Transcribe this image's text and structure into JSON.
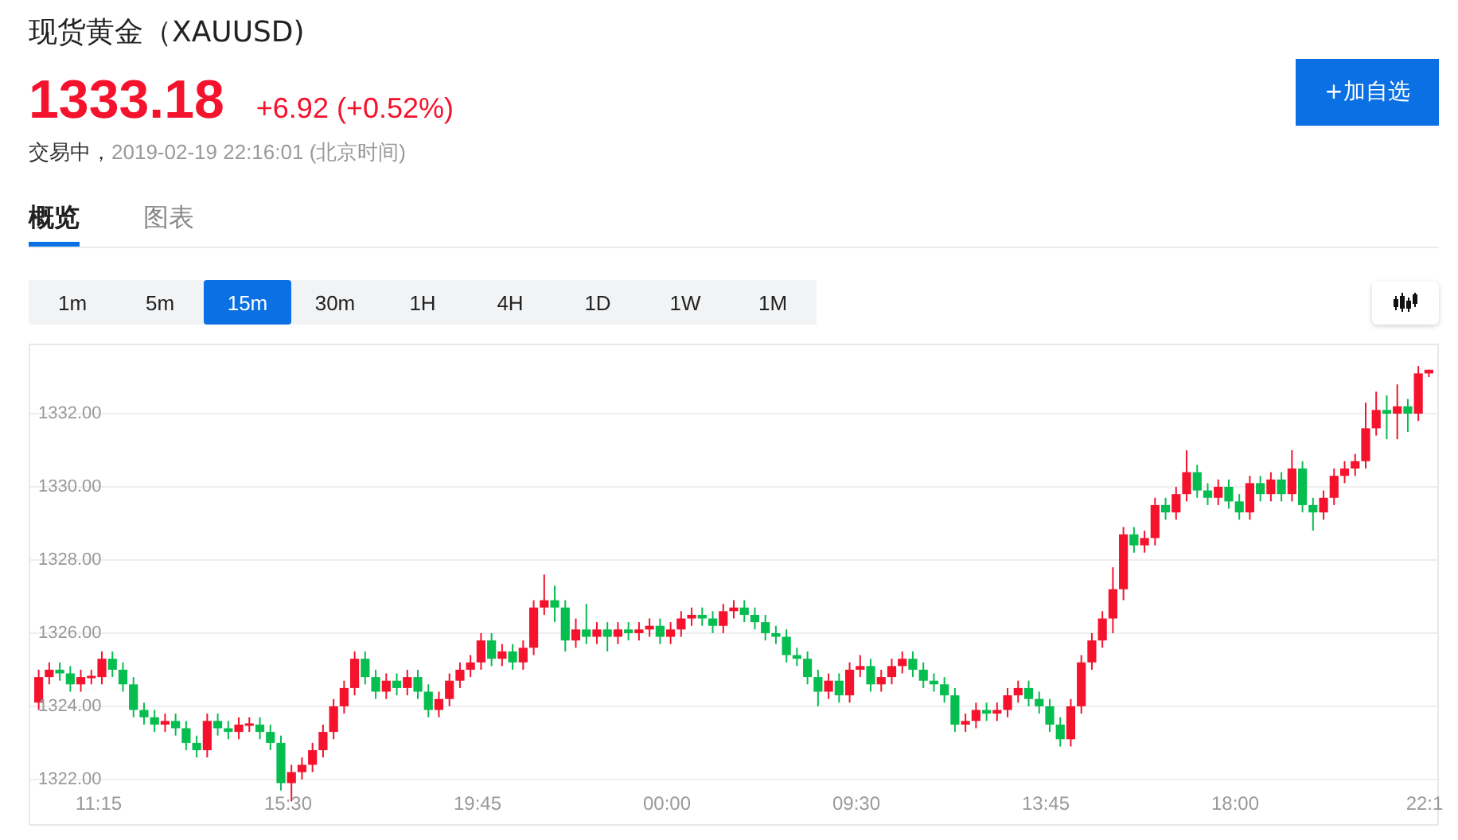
{
  "header": {
    "title": "现货黄金（XAUUSD)",
    "price": "1333.18",
    "change": "+6.92 (+0.52%)",
    "status": "交易中，",
    "time": "2019-02-19 22:16:01 (北京时间)"
  },
  "follow_button": "+加自选",
  "tabs": [
    {
      "label": "概览",
      "selected": true
    },
    {
      "label": "图表",
      "selected": false
    }
  ],
  "periods": [
    {
      "label": "1m",
      "selected": false
    },
    {
      "label": "5m",
      "selected": false
    },
    {
      "label": "15m",
      "selected": true
    },
    {
      "label": "30m",
      "selected": false
    },
    {
      "label": "1H",
      "selected": false
    },
    {
      "label": "4H",
      "selected": false
    },
    {
      "label": "1D",
      "selected": false
    },
    {
      "label": "1W",
      "selected": false
    },
    {
      "label": "1M",
      "selected": false
    }
  ],
  "chart": {
    "x_labels": [
      "11:15",
      "15:30",
      "19:45",
      "00:00",
      "09:30",
      "13:45",
      "18:00",
      "22:1"
    ],
    "chart_data": {
      "type": "candlestick",
      "grid": true,
      "ylim": [
        1320.78,
        1333.87
      ],
      "yticks": [
        {
          "value": 1332,
          "label": "1332.00"
        },
        {
          "value": 1330,
          "label": "1330.00"
        },
        {
          "value": 1328,
          "label": "1328.00"
        },
        {
          "value": 1326,
          "label": "1326.00"
        },
        {
          "value": 1324,
          "label": "1324.00"
        },
        {
          "value": 1322,
          "label": "1322.00"
        }
      ],
      "ohlc": [
        [
          1324.1,
          1325.0,
          1323.9,
          1324.8
        ],
        [
          1324.8,
          1325.2,
          1324.6,
          1325.0
        ],
        [
          1325.0,
          1325.2,
          1324.7,
          1324.9
        ],
        [
          1324.9,
          1325.1,
          1324.4,
          1324.6
        ],
        [
          1324.6,
          1325.0,
          1324.4,
          1324.8
        ],
        [
          1324.8,
          1325.0,
          1324.6,
          1324.8
        ],
        [
          1324.8,
          1325.5,
          1324.6,
          1325.3
        ],
        [
          1325.3,
          1325.5,
          1324.8,
          1325.0
        ],
        [
          1325.0,
          1325.2,
          1324.4,
          1324.6
        ],
        [
          1324.6,
          1324.8,
          1323.7,
          1323.9
        ],
        [
          1323.9,
          1324.1,
          1323.5,
          1323.7
        ],
        [
          1323.7,
          1323.9,
          1323.3,
          1323.5
        ],
        [
          1323.5,
          1323.8,
          1323.3,
          1323.6
        ],
        [
          1323.6,
          1323.8,
          1323.2,
          1323.4
        ],
        [
          1323.4,
          1323.6,
          1322.8,
          1323.0
        ],
        [
          1323.0,
          1323.2,
          1322.6,
          1322.8
        ],
        [
          1322.8,
          1323.8,
          1322.6,
          1323.6
        ],
        [
          1323.6,
          1323.8,
          1323.2,
          1323.4
        ],
        [
          1323.4,
          1323.6,
          1323.1,
          1323.3
        ],
        [
          1323.3,
          1323.7,
          1323.1,
          1323.5
        ],
        [
          1323.5,
          1323.7,
          1323.3,
          1323.5
        ],
        [
          1323.5,
          1323.7,
          1323.1,
          1323.3
        ],
        [
          1323.3,
          1323.5,
          1322.8,
          1323.0
        ],
        [
          1323.0,
          1323.2,
          1321.7,
          1321.9
        ],
        [
          1321.9,
          1322.4,
          1321.4,
          1322.2
        ],
        [
          1322.2,
          1322.6,
          1322.0,
          1322.4
        ],
        [
          1322.4,
          1323.0,
          1322.2,
          1322.8
        ],
        [
          1322.8,
          1323.5,
          1322.6,
          1323.3
        ],
        [
          1323.3,
          1324.2,
          1323.1,
          1324.0
        ],
        [
          1324.0,
          1324.7,
          1323.8,
          1324.5
        ],
        [
          1324.5,
          1325.5,
          1324.3,
          1325.3
        ],
        [
          1325.3,
          1325.5,
          1324.6,
          1324.8
        ],
        [
          1324.8,
          1325.0,
          1324.2,
          1324.4
        ],
        [
          1324.4,
          1324.9,
          1324.2,
          1324.7
        ],
        [
          1324.7,
          1324.9,
          1324.3,
          1324.5
        ],
        [
          1324.5,
          1325.0,
          1324.3,
          1324.8
        ],
        [
          1324.8,
          1325.0,
          1324.2,
          1324.4
        ],
        [
          1324.4,
          1324.6,
          1323.7,
          1323.9
        ],
        [
          1323.9,
          1324.4,
          1323.7,
          1324.2
        ],
        [
          1324.2,
          1324.9,
          1324.0,
          1324.7
        ],
        [
          1324.7,
          1325.2,
          1324.5,
          1325.0
        ],
        [
          1325.0,
          1325.4,
          1324.8,
          1325.2
        ],
        [
          1325.2,
          1326.0,
          1325.0,
          1325.8
        ],
        [
          1325.8,
          1326.0,
          1325.1,
          1325.3
        ],
        [
          1325.3,
          1325.7,
          1325.1,
          1325.5
        ],
        [
          1325.5,
          1325.7,
          1325.0,
          1325.2
        ],
        [
          1325.2,
          1325.8,
          1325.0,
          1325.6
        ],
        [
          1325.6,
          1326.9,
          1325.4,
          1326.7
        ],
        [
          1326.7,
          1327.6,
          1326.5,
          1326.9
        ],
        [
          1326.9,
          1327.3,
          1326.3,
          1326.7
        ],
        [
          1326.7,
          1326.9,
          1325.5,
          1325.8
        ],
        [
          1325.8,
          1326.4,
          1325.6,
          1326.1
        ],
        [
          1326.1,
          1326.8,
          1325.7,
          1325.9
        ],
        [
          1325.9,
          1326.3,
          1325.7,
          1326.1
        ],
        [
          1326.1,
          1326.3,
          1325.5,
          1325.9
        ],
        [
          1325.9,
          1326.3,
          1325.7,
          1326.1
        ],
        [
          1326.1,
          1326.3,
          1325.8,
          1326.0
        ],
        [
          1326.0,
          1326.3,
          1325.8,
          1326.1
        ],
        [
          1326.1,
          1326.4,
          1325.9,
          1326.2
        ],
        [
          1326.2,
          1326.4,
          1325.7,
          1325.9
        ],
        [
          1325.9,
          1326.3,
          1325.7,
          1326.1
        ],
        [
          1326.1,
          1326.6,
          1325.9,
          1326.4
        ],
        [
          1326.4,
          1326.7,
          1326.2,
          1326.5
        ],
        [
          1326.5,
          1326.7,
          1326.2,
          1326.4
        ],
        [
          1326.4,
          1326.6,
          1326.0,
          1326.2
        ],
        [
          1326.2,
          1326.8,
          1326.0,
          1326.6
        ],
        [
          1326.6,
          1326.9,
          1326.4,
          1326.7
        ],
        [
          1326.7,
          1326.9,
          1326.3,
          1326.5
        ],
        [
          1326.5,
          1326.7,
          1326.1,
          1326.3
        ],
        [
          1326.3,
          1326.5,
          1325.8,
          1326.0
        ],
        [
          1326.0,
          1326.2,
          1325.7,
          1325.9
        ],
        [
          1325.9,
          1326.1,
          1325.2,
          1325.4
        ],
        [
          1325.4,
          1325.6,
          1325.1,
          1325.3
        ],
        [
          1325.3,
          1325.5,
          1324.6,
          1324.8
        ],
        [
          1324.8,
          1325.0,
          1324.0,
          1324.4
        ],
        [
          1324.4,
          1324.9,
          1324.2,
          1324.7
        ],
        [
          1324.7,
          1324.9,
          1324.1,
          1324.3
        ],
        [
          1324.3,
          1325.2,
          1324.1,
          1325.0
        ],
        [
          1325.0,
          1325.4,
          1324.8,
          1325.1
        ],
        [
          1325.1,
          1325.3,
          1324.4,
          1324.6
        ],
        [
          1324.6,
          1325.0,
          1324.4,
          1324.8
        ],
        [
          1324.8,
          1325.3,
          1324.6,
          1325.1
        ],
        [
          1325.1,
          1325.5,
          1324.9,
          1325.3
        ],
        [
          1325.3,
          1325.5,
          1324.8,
          1325.0
        ],
        [
          1325.0,
          1325.2,
          1324.5,
          1324.7
        ],
        [
          1324.7,
          1324.9,
          1324.4,
          1324.6
        ],
        [
          1324.6,
          1324.8,
          1324.1,
          1324.3
        ],
        [
          1324.3,
          1324.5,
          1323.3,
          1323.5
        ],
        [
          1323.5,
          1323.8,
          1323.3,
          1323.6
        ],
        [
          1323.6,
          1324.1,
          1323.4,
          1323.9
        ],
        [
          1323.9,
          1324.1,
          1323.6,
          1323.8
        ],
        [
          1323.8,
          1324.1,
          1323.6,
          1323.9
        ],
        [
          1323.9,
          1324.5,
          1323.7,
          1324.3
        ],
        [
          1324.3,
          1324.7,
          1324.1,
          1324.5
        ],
        [
          1324.5,
          1324.7,
          1324.0,
          1324.2
        ],
        [
          1324.2,
          1324.4,
          1323.8,
          1324.0
        ],
        [
          1324.0,
          1324.2,
          1323.3,
          1323.5
        ],
        [
          1323.5,
          1323.7,
          1322.9,
          1323.1
        ],
        [
          1323.1,
          1324.2,
          1322.9,
          1324.0
        ],
        [
          1324.0,
          1325.4,
          1323.8,
          1325.2
        ],
        [
          1325.2,
          1326.0,
          1325.0,
          1325.8
        ],
        [
          1325.8,
          1326.6,
          1325.6,
          1326.4
        ],
        [
          1326.4,
          1327.8,
          1326.0,
          1327.2
        ],
        [
          1327.2,
          1328.9,
          1326.9,
          1328.7
        ],
        [
          1328.7,
          1328.9,
          1328.2,
          1328.4
        ],
        [
          1328.4,
          1328.8,
          1328.2,
          1328.6
        ],
        [
          1328.6,
          1329.7,
          1328.4,
          1329.5
        ],
        [
          1329.5,
          1329.7,
          1329.1,
          1329.3
        ],
        [
          1329.3,
          1330.0,
          1329.1,
          1329.8
        ],
        [
          1329.8,
          1331.0,
          1329.6,
          1330.4
        ],
        [
          1330.4,
          1330.6,
          1329.7,
          1329.9
        ],
        [
          1329.9,
          1330.1,
          1329.5,
          1329.7
        ],
        [
          1329.7,
          1330.2,
          1329.5,
          1330.0
        ],
        [
          1330.0,
          1330.2,
          1329.4,
          1329.6
        ],
        [
          1329.6,
          1329.8,
          1329.1,
          1329.3
        ],
        [
          1329.3,
          1330.3,
          1329.1,
          1330.1
        ],
        [
          1330.1,
          1330.3,
          1329.6,
          1329.8
        ],
        [
          1329.8,
          1330.4,
          1329.6,
          1330.2
        ],
        [
          1330.2,
          1330.4,
          1329.6,
          1329.8
        ],
        [
          1329.8,
          1331.0,
          1329.6,
          1330.5
        ],
        [
          1330.5,
          1330.7,
          1329.3,
          1329.5
        ],
        [
          1329.5,
          1329.7,
          1328.8,
          1329.3
        ],
        [
          1329.3,
          1329.9,
          1329.1,
          1329.7
        ],
        [
          1329.7,
          1330.5,
          1329.5,
          1330.3
        ],
        [
          1330.3,
          1330.7,
          1330.1,
          1330.5
        ],
        [
          1330.5,
          1330.9,
          1330.3,
          1330.7
        ],
        [
          1330.7,
          1332.3,
          1330.5,
          1331.6
        ],
        [
          1331.6,
          1332.6,
          1331.4,
          1332.1
        ],
        [
          1332.1,
          1332.5,
          1331.3,
          1332.0
        ],
        [
          1332.0,
          1332.8,
          1331.3,
          1332.2
        ],
        [
          1332.2,
          1332.4,
          1331.5,
          1332.0
        ],
        [
          1332.0,
          1333.3,
          1331.8,
          1333.1
        ],
        [
          1333.1,
          1333.2,
          1333.0,
          1333.2
        ]
      ]
    }
  }
}
